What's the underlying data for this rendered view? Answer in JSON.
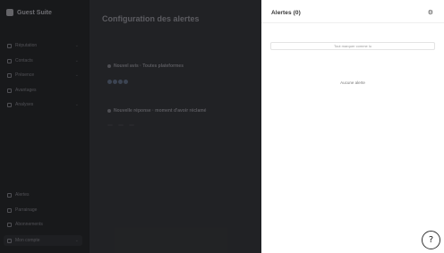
{
  "app": {
    "name": "Guest Suite"
  },
  "sidebar": {
    "items": [
      {
        "label": "Réputation"
      },
      {
        "label": "Contacts"
      },
      {
        "label": "Présence"
      },
      {
        "label": "Avantages"
      },
      {
        "label": "Analyses"
      }
    ],
    "bottom_items": [
      {
        "label": "Alertes"
      },
      {
        "label": "Parrainage"
      },
      {
        "label": "Abonnements"
      }
    ],
    "account": {
      "label": "Mon compte"
    }
  },
  "main": {
    "title": "Configuration des alertes",
    "description": "",
    "groups": [
      {
        "title": "Nouvel avis · Toutes plateformes",
        "chips": [
          "",
          "",
          "",
          ""
        ]
      },
      {
        "title": "Nouvelle réponse · moment d'avoir réclamé",
        "chips": [
          "",
          "",
          "",
          ""
        ]
      }
    ]
  },
  "panel": {
    "title": "Alertes (0)",
    "mark_all_label": "Tout marquer comme lu",
    "empty_label": "Aucune alerte"
  },
  "help": {
    "label": "?"
  }
}
